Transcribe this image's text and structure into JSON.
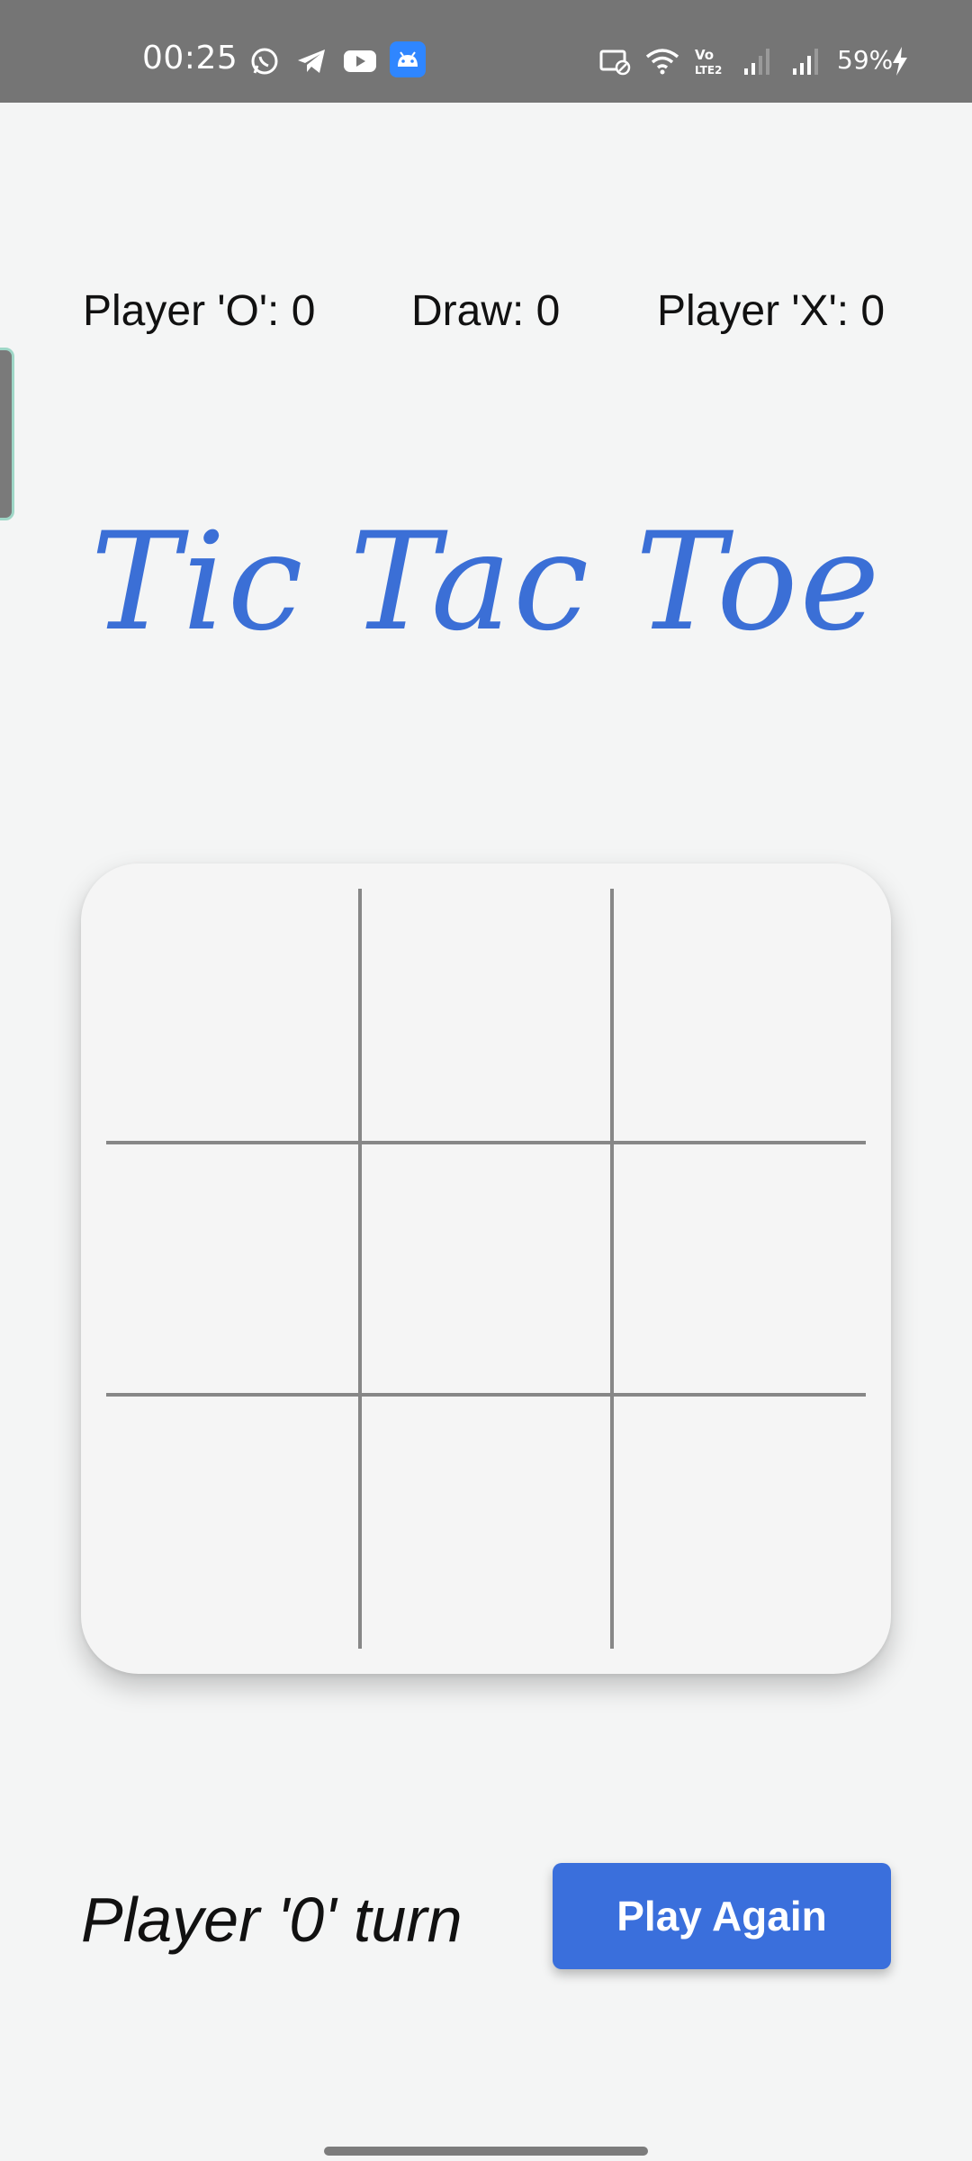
{
  "status_bar": {
    "time": "00:25",
    "battery_percent": "59%",
    "left_icons": [
      "whatsapp-icon",
      "telegram-icon",
      "youtube-icon",
      "android-icon"
    ],
    "right_icons": [
      "cast-off-icon",
      "wifi-icon",
      "volte-icon",
      "signal-weak-icon",
      "signal-icon",
      "battery-charging-icon"
    ]
  },
  "scores": {
    "player_o": "Player 'O': 0",
    "draw": "Draw: 0",
    "player_x": "Player 'X': 0"
  },
  "title": "Tic Tac Toe",
  "board": {
    "cells": [
      "",
      "",
      "",
      "",
      "",
      "",
      "",
      "",
      ""
    ]
  },
  "turn_text": "Player '0' turn",
  "play_again_label": "Play Again",
  "colors": {
    "accent": "#3a6fdc",
    "title": "#3b6fd6",
    "grid_line": "#878787",
    "background": "#f4f5f5",
    "status_bar": "#757575"
  }
}
